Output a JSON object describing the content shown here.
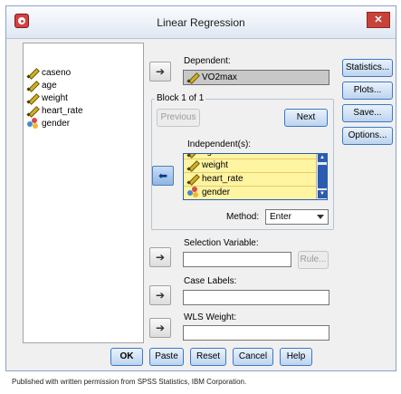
{
  "window": {
    "title": "Linear Regression",
    "close_glyph": "✕",
    "icon": "spss-app-icon"
  },
  "variables": [
    {
      "name": "caseno",
      "icon": "scale-pencil-icon"
    },
    {
      "name": "age",
      "icon": "scale-pencil-icon"
    },
    {
      "name": "weight",
      "icon": "scale-pencil-icon"
    },
    {
      "name": "heart_rate",
      "icon": "scale-pencil-icon"
    },
    {
      "name": "gender",
      "icon": "nominal-icon"
    }
  ],
  "dependent": {
    "label": "Dependent:",
    "value": "VO2max"
  },
  "block": {
    "legend": "Block 1 of 1",
    "previous_label": "Previous",
    "next_label": "Next"
  },
  "independents": {
    "label": "Independent(s):",
    "items": [
      "age",
      "weight",
      "heart_rate",
      "gender"
    ]
  },
  "method": {
    "label": "Method:",
    "value": "Enter"
  },
  "selection_variable": {
    "label": "Selection Variable:",
    "rule_label": "Rule..."
  },
  "case_labels": {
    "label": "Case Labels:"
  },
  "wls_weight": {
    "label": "WLS Weight:"
  },
  "side_buttons": {
    "statistics": "Statistics...",
    "plots": "Plots...",
    "save": "Save...",
    "options": "Options..."
  },
  "bottom_buttons": {
    "ok": "OK",
    "paste": "Paste",
    "reset": "Reset",
    "cancel": "Cancel",
    "help": "Help"
  },
  "footer_text": "Published with written permission from SPSS Statistics, IBM Corporation.",
  "colors": {
    "selection_highlight": "#fff4a2",
    "active_arrow": "#8fb5e3"
  }
}
